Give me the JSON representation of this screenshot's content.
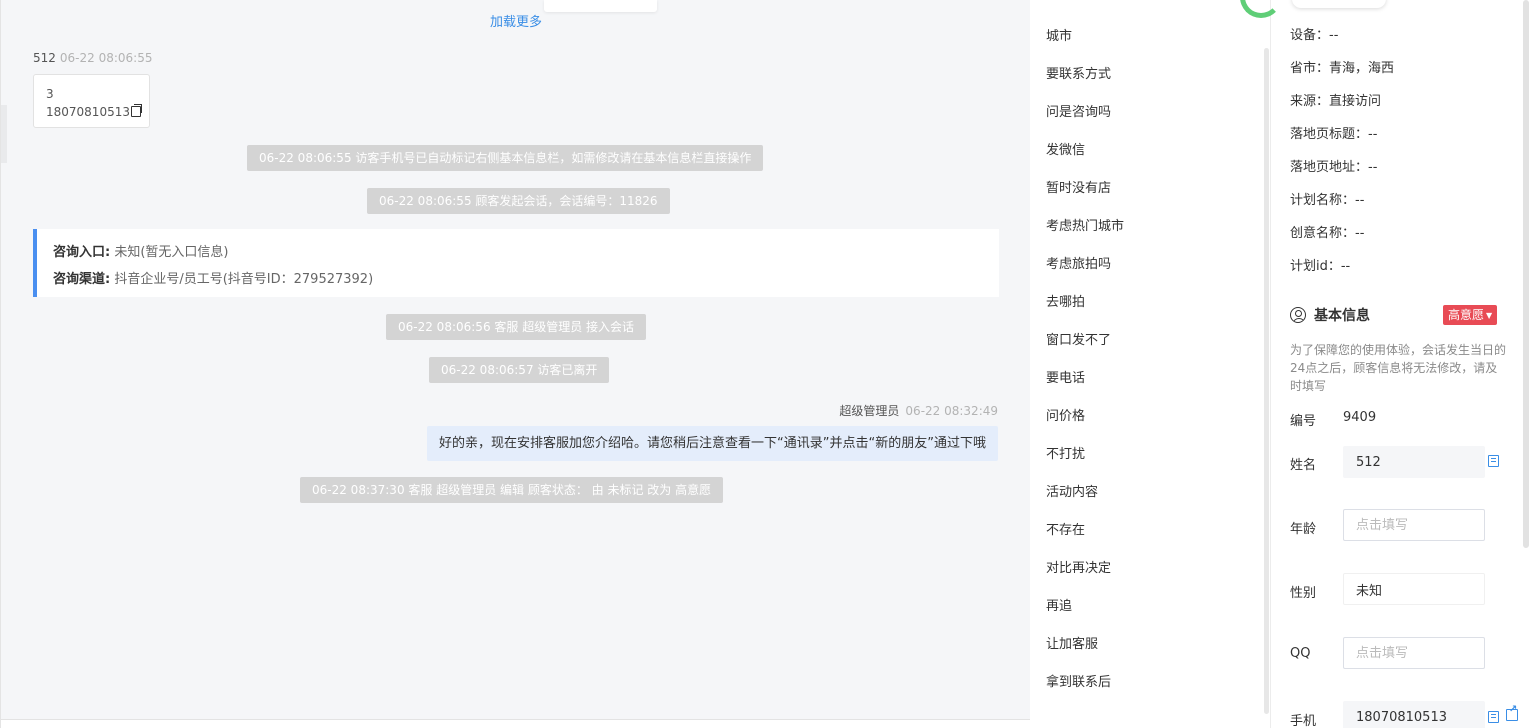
{
  "chat": {
    "load_more": "加载更多",
    "incoming": {
      "sender": "512",
      "time": "06-22 08:06:55",
      "line1": "3",
      "line2": "18070810513"
    },
    "system": [
      "06-22 08:06:55 访客手机号已自动标记右侧基本信息栏，如需修改请在基本信息栏直接操作",
      "06-22 08:06:55 顾客发起会话，会话编号：11826",
      "06-22 08:06:56 客服 超级管理员 接入会话",
      "06-22 08:06:57 访客已离开",
      "06-22 08:37:30 客服 超级管理员 编辑 顾客状态： 由 未标记 改为 高意愿"
    ],
    "consult": {
      "entry_label": "咨询入口:",
      "entry_value": "未知(暂无入口信息)",
      "channel_label": "咨询渠道:",
      "channel_value": "抖音企业号/员工号(抖音号ID：279527392)"
    },
    "outgoing": {
      "sender": "超级管理员",
      "time": "06-22 08:32:49",
      "text": "好的亲，现在安排客服加您介绍哈。请您稍后注意查看一下“通讯录”并点击“新的朋友”通过下哦"
    }
  },
  "quick_replies": [
    "城市",
    "要联系方式",
    "问是咨询吗",
    "发微信",
    "暂时没有店",
    "考虑热门城市",
    "考虑旅拍吗",
    "去哪拍",
    "窗口发不了",
    "要电话",
    "问价格",
    "不打扰",
    "活动内容",
    "不存在",
    "对比再决定",
    "再追",
    "让加客服",
    "拿到联系后"
  ],
  "visitor_info": [
    "设备：--",
    "省市：青海，海西",
    "来源：直接访问",
    "落地页标题：--",
    "落地页地址：--",
    "计划名称：--",
    "创意名称：--",
    "计划id：--"
  ],
  "basic_info": {
    "title": "基本信息",
    "intent": "高意愿",
    "notice": "为了保障您的使用体验，会话发生当日的24点之后，顾客信息将无法修改，请及时填写",
    "id_label": "编号",
    "id_value": "9409",
    "name_label": "姓名",
    "name_value": "512",
    "age_label": "年龄",
    "age_placeholder": "点击填写",
    "gender_label": "性别",
    "gender_value": "未知",
    "qq_label": "QQ",
    "qq_placeholder": "点击填写",
    "phone_label": "手机",
    "phone_value": "18070810513"
  },
  "colors": {
    "accent": "#3a8ee6",
    "intent_badge": "#e84b55",
    "consult_border": "#4a8ff0",
    "system_bubble": "#d4d4d4",
    "outgoing_bubble": "#e4edfb"
  }
}
